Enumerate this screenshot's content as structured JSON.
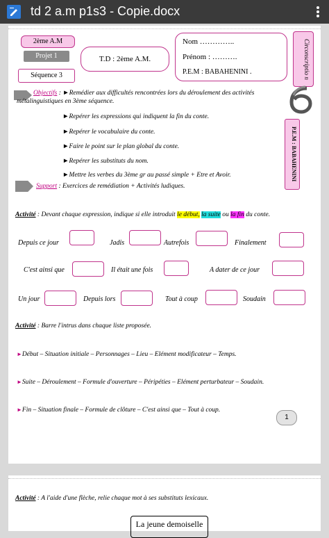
{
  "app": {
    "title": "td 2 a.m p1s3 - Copie.docx"
  },
  "header": {
    "level": "2ème A.M",
    "projet": "Projet 1",
    "sequence": "Séquence 3",
    "td": "T.D : 2ème A.M.",
    "nom": "Nom …………..",
    "prenom": "Prénom : ……….",
    "pem": "P.E.M : BABAHENINI .",
    "circonscription": "Circonscriptio n",
    "vertical_pem": "P.E.M : BABAHENINI"
  },
  "objectifs": {
    "label": "Objectifs",
    "first": ": ►Remédier aux difficultés rencontrées lors du déroulement des activités",
    "first_cont": "métalinguistiques en 3ème séquence.",
    "items": [
      "►Repérer les expressions qui indiquent la fin du conte.",
      "►Repérer le vocabulaire du conte.",
      "►Faire le point sur le plan global du conte.",
      "►Repérer les substituts du nom.",
      "►Mettre les verbes du 3ème gr au passé simple + Etre et Avoir."
    ]
  },
  "support": {
    "label": "Support",
    "text": ": Exercices de remédiation + Activités ludiques."
  },
  "activite1": {
    "label": "Activité",
    "text_before": ": Devant chaque expression, indique si elle introduit",
    "debut": "le début,",
    "suite": "la suite",
    "ou": "ou",
    "fin": "la fin",
    "text_after": "du conte.",
    "rows": [
      [
        "Depuis ce jour",
        "Jadis",
        "Autrefois",
        "Finalement"
      ],
      [
        "C'est ainsi que",
        "Il était une fois",
        "A dater de ce jour"
      ],
      [
        "Un jour",
        "Depuis lors",
        "Tout à coup",
        "Soudain"
      ]
    ]
  },
  "activite2": {
    "label": "Activité",
    "text": ": Barre l'intrus dans chaque liste proposée.",
    "lists": [
      "Début – Situation initiale – Personnages – Lieu – Elément modificateur – Temps.",
      "Suite – Déroulement – Formule d'ouverture – Péripéties – Elément perturbateur – Soudain.",
      "Fin – Situation finale – Formule de clôture – C'est ainsi que – Tout à coup."
    ]
  },
  "page_number": "1",
  "activite3": {
    "label": "Activité",
    "text": ": A l'aide d'une flèche, relie chaque mot à ses substituts lexicaux.",
    "box": "La jeune demoiselle"
  }
}
